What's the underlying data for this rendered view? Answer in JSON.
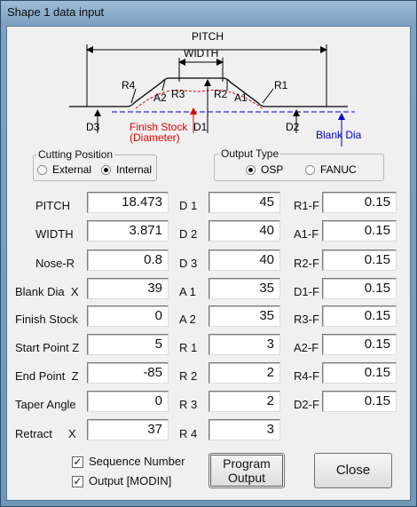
{
  "window": {
    "title": "Shape 1 data input"
  },
  "diagram": {
    "pitch": "PITCH",
    "width": "WIDTH",
    "r4": "R4",
    "r3": "R3",
    "r2": "R2",
    "r1": "R1",
    "a2": "A2",
    "a1": "A1",
    "d3": "D3",
    "d1": "D1",
    "d2": "D2",
    "finish_stock": "Finish Stock",
    "finish_stock_sub": "(Diameter)",
    "blank_dia": "Blank Dia",
    "colors": {
      "finish": "#e00000",
      "blank": "#0000cc",
      "line": "#000000"
    }
  },
  "cutting_position": {
    "title": "Cutting Position",
    "options": [
      "External",
      "Internal"
    ],
    "selected": "Internal"
  },
  "output_type": {
    "title": "Output Type",
    "options": [
      "OSP",
      "FANUC"
    ],
    "selected": "OSP"
  },
  "fields_left": [
    {
      "label": "PITCH",
      "value": "18.473"
    },
    {
      "label": "WIDTH",
      "value": "3.871"
    },
    {
      "label": "Nose-R",
      "value": "0.8"
    },
    {
      "label": "Blank Dia  X",
      "value": "39"
    },
    {
      "label": "Finish Stock",
      "value": "0"
    },
    {
      "label": "Start Point Z",
      "value": "5"
    },
    {
      "label": "End Point  Z",
      "value": "-85"
    },
    {
      "label": "Taper Angle",
      "value": "0"
    },
    {
      "label": "Retract     X",
      "value": "37"
    }
  ],
  "fields_mid": [
    {
      "label": "D 1",
      "value": "45"
    },
    {
      "label": "D 2",
      "value": "40"
    },
    {
      "label": "D 3",
      "value": "40"
    },
    {
      "label": "A 1",
      "value": "35"
    },
    {
      "label": "A 2",
      "value": "35"
    },
    {
      "label": "R 1",
      "value": "3"
    },
    {
      "label": "R 2",
      "value": "2"
    },
    {
      "label": "R 3",
      "value": "2"
    },
    {
      "label": "R 4",
      "value": "3"
    }
  ],
  "fields_right": [
    {
      "label": "R1-F",
      "value": "0.15"
    },
    {
      "label": "A1-F",
      "value": "0.15"
    },
    {
      "label": "R2-F",
      "value": "0.15"
    },
    {
      "label": "D1-F",
      "value": "0.15"
    },
    {
      "label": "R3-F",
      "value": "0.15"
    },
    {
      "label": "A2-F",
      "value": "0.15"
    },
    {
      "label": "R4-F",
      "value": "0.15"
    },
    {
      "label": "D2-F",
      "value": "0.15"
    }
  ],
  "options": {
    "sequence_number": {
      "label": "Sequence Number",
      "checked": true
    },
    "output_modin": {
      "label": "Output [MODIN]",
      "checked": true
    }
  },
  "buttons": {
    "program_output_line1": "Program",
    "program_output_line2": "Output",
    "close": "Close"
  }
}
